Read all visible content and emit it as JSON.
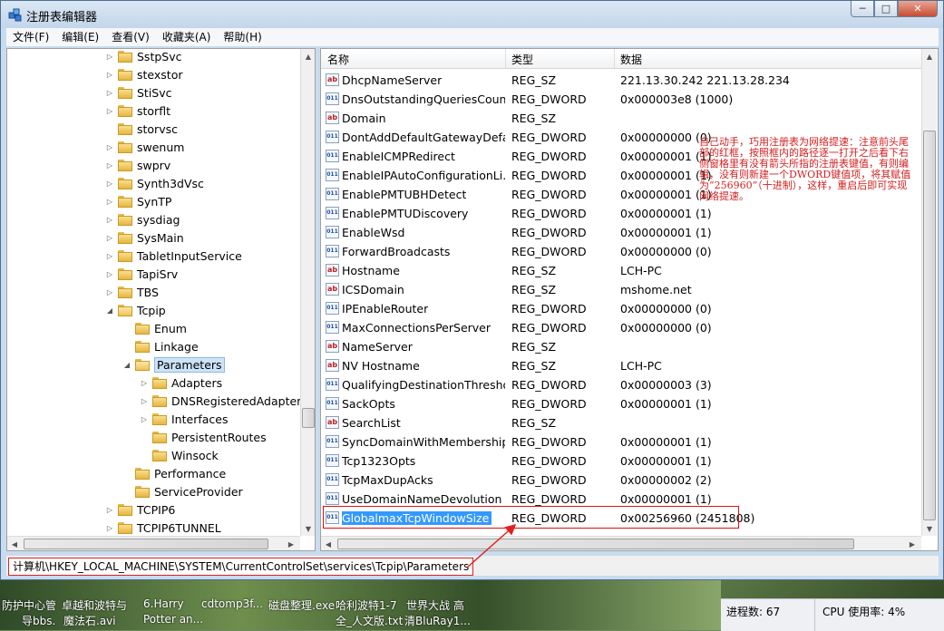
{
  "window": {
    "title": "注册表编辑器"
  },
  "caption": {
    "minimize": "─",
    "maximize": "□",
    "close": "✕"
  },
  "menu": [
    "文件(F)",
    "编辑(E)",
    "查看(V)",
    "收藏夹(A)",
    "帮助(H)"
  ],
  "tree": [
    {
      "label": "SstpSvc",
      "level": 0,
      "expander": "closed"
    },
    {
      "label": "stexstor",
      "level": 0,
      "expander": "closed"
    },
    {
      "label": "StiSvc",
      "level": 0,
      "expander": "closed"
    },
    {
      "label": "storflt",
      "level": 0,
      "expander": "closed"
    },
    {
      "label": "storvsc",
      "level": 0,
      "expander": "none"
    },
    {
      "label": "swenum",
      "level": 0,
      "expander": "closed"
    },
    {
      "label": "swprv",
      "level": 0,
      "expander": "closed"
    },
    {
      "label": "Synth3dVsc",
      "level": 0,
      "expander": "closed"
    },
    {
      "label": "SynTP",
      "level": 0,
      "expander": "closed"
    },
    {
      "label": "sysdiag",
      "level": 0,
      "expander": "closed"
    },
    {
      "label": "SysMain",
      "level": 0,
      "expander": "closed"
    },
    {
      "label": "TabletInputService",
      "level": 0,
      "expander": "closed"
    },
    {
      "label": "TapiSrv",
      "level": 0,
      "expander": "closed"
    },
    {
      "label": "TBS",
      "level": 0,
      "expander": "closed"
    },
    {
      "label": "Tcpip",
      "level": 0,
      "expander": "open"
    },
    {
      "label": "Enum",
      "level": 1,
      "expander": "none"
    },
    {
      "label": "Linkage",
      "level": 1,
      "expander": "none"
    },
    {
      "label": "Parameters",
      "level": 1,
      "expander": "open",
      "selected": true
    },
    {
      "label": "Adapters",
      "level": 2,
      "expander": "closed"
    },
    {
      "label": "DNSRegisteredAdapters",
      "level": 2,
      "expander": "closed"
    },
    {
      "label": "Interfaces",
      "level": 2,
      "expander": "closed"
    },
    {
      "label": "PersistentRoutes",
      "level": 2,
      "expander": "none"
    },
    {
      "label": "Winsock",
      "level": 2,
      "expander": "none"
    },
    {
      "label": "Performance",
      "level": 1,
      "expander": "none"
    },
    {
      "label": "ServiceProvider",
      "level": 1,
      "expander": "none"
    },
    {
      "label": "TCPIP6",
      "level": 0,
      "expander": "closed"
    },
    {
      "label": "TCPIP6TUNNEL",
      "level": 0,
      "expander": "closed"
    }
  ],
  "list_headers": {
    "name": "名称",
    "type": "类型",
    "data": "数据"
  },
  "values": [
    {
      "name": "DhcpNameServer",
      "type": "REG_SZ",
      "data": "221.13.30.242 221.13.28.234"
    },
    {
      "name": "DnsOutstandingQueriesCount",
      "type": "REG_DWORD",
      "data": "0x000003e8 (1000)"
    },
    {
      "name": "Domain",
      "type": "REG_SZ",
      "data": ""
    },
    {
      "name": "DontAddDefaultGatewayDefa...",
      "type": "REG_DWORD",
      "data": "0x00000000 (0)"
    },
    {
      "name": "EnableICMPRedirect",
      "type": "REG_DWORD",
      "data": "0x00000001 (1)"
    },
    {
      "name": "EnableIPAutoConfigurationLi...",
      "type": "REG_DWORD",
      "data": "0x00000001 (1)"
    },
    {
      "name": "EnablePMTUBHDetect",
      "type": "REG_DWORD",
      "data": "0x00000001 (1)"
    },
    {
      "name": "EnablePMTUDiscovery",
      "type": "REG_DWORD",
      "data": "0x00000001 (1)"
    },
    {
      "name": "EnableWsd",
      "type": "REG_DWORD",
      "data": "0x00000001 (1)"
    },
    {
      "name": "ForwardBroadcasts",
      "type": "REG_DWORD",
      "data": "0x00000000 (0)"
    },
    {
      "name": "Hostname",
      "type": "REG_SZ",
      "data": "LCH-PC"
    },
    {
      "name": "ICSDomain",
      "type": "REG_SZ",
      "data": "mshome.net"
    },
    {
      "name": "IPEnableRouter",
      "type": "REG_DWORD",
      "data": "0x00000000 (0)"
    },
    {
      "name": "MaxConnectionsPerServer",
      "type": "REG_DWORD",
      "data": "0x00000000 (0)"
    },
    {
      "name": "NameServer",
      "type": "REG_SZ",
      "data": ""
    },
    {
      "name": "NV Hostname",
      "type": "REG_SZ",
      "data": "LCH-PC"
    },
    {
      "name": "QualifyingDestinationThresho...",
      "type": "REG_DWORD",
      "data": "0x00000003 (3)"
    },
    {
      "name": "SackOpts",
      "type": "REG_DWORD",
      "data": "0x00000001 (1)"
    },
    {
      "name": "SearchList",
      "type": "REG_SZ",
      "data": ""
    },
    {
      "name": "SyncDomainWithMembership",
      "type": "REG_DWORD",
      "data": "0x00000001 (1)"
    },
    {
      "name": "Tcp1323Opts",
      "type": "REG_DWORD",
      "data": "0x00000001 (1)"
    },
    {
      "name": "TcpMaxDupAcks",
      "type": "REG_DWORD",
      "data": "0x00000002 (2)"
    },
    {
      "name": "UseDomainNameDevolution",
      "type": "REG_DWORD",
      "data": "0x00000001 (1)"
    },
    {
      "name": "GlobalmaxTcpWindowSize",
      "type": "REG_DWORD",
      "data": "0x00256960 (2451808)",
      "selected": true
    }
  ],
  "annotation": "自己动手，巧用注册表为网络提速：注意前头尾部的红框，按照框内的路径逐一打开之后看下右侧窗格里有没有箭头所指的注册表键值，有则编辑，没有则新建一个DWORD键值项，将其赋值为“256960”（十进制），这样，重启后即可实现网络提速。",
  "status": {
    "path": "计算机\\HKEY_LOCAL_MACHINE\\SYSTEM\\CurrentControlSet\\services\\Tcpip\\Parameters"
  },
  "taskbar": {
    "items": [
      "防护中心管",
      "卓越和波特与",
      "6.Harry",
      "cdtomp3f...",
      "磁盘整理.exe",
      "哈利波特1-7",
      "世界大战 高"
    ],
    "items2": [
      "导bbs.",
      "魔法石.avi",
      "Potter an...",
      "全_人文版.txt",
      "清BluRay1..."
    ]
  },
  "perf": {
    "processes": "进程数: 67",
    "cpu": "CPU 使用率: 4%"
  }
}
